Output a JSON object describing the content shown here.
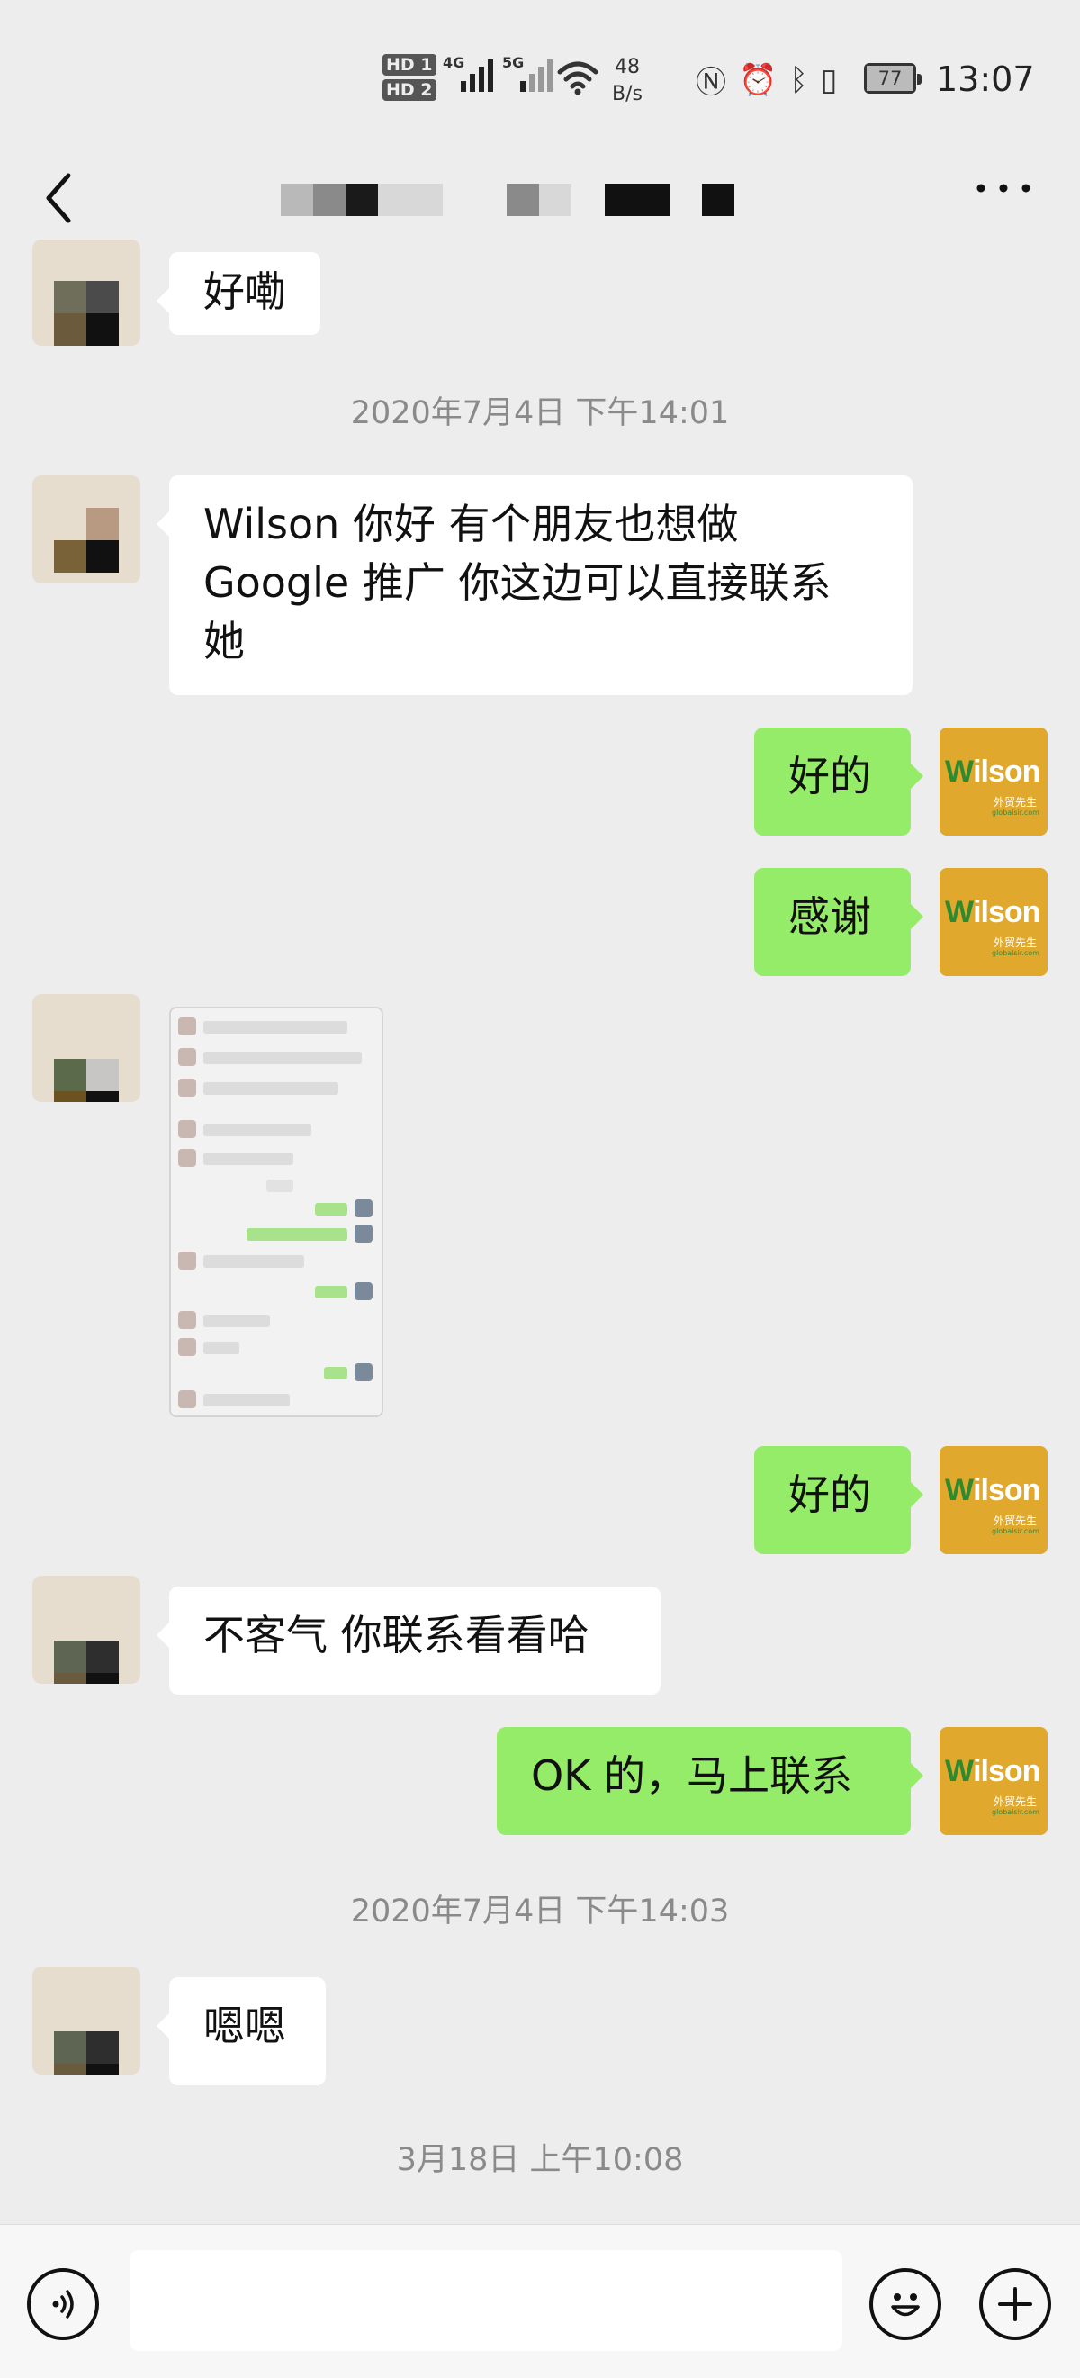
{
  "status_bar": {
    "sim1": "HD 1",
    "sim2": "HD 2",
    "net1": "4G",
    "net2": "5G",
    "speed_value": "48",
    "speed_unit": "B/s",
    "battery": "77",
    "time": "13:07"
  },
  "nav": {
    "back_icon": "chevron-left-icon",
    "more_icon": "more-dots-icon",
    "title_redacted": true
  },
  "messages": [
    {
      "side": "in",
      "text": "好嘞"
    },
    {
      "type": "time",
      "text": "2020年7月4日 下午14:01"
    },
    {
      "side": "in",
      "text": "Wilson 你好 有个朋友也想做\nGoogle 推广 你这边可以直接联系\n她"
    },
    {
      "side": "out",
      "text": "好的"
    },
    {
      "side": "out",
      "text": "感谢"
    },
    {
      "side": "in",
      "type": "image"
    },
    {
      "side": "out",
      "text": "好的"
    },
    {
      "side": "in",
      "text": "不客气 你联系看看哈"
    },
    {
      "side": "out",
      "text": "OK 的，马上联系"
    },
    {
      "type": "time",
      "text": "2020年7月4日 下午14:03"
    },
    {
      "side": "in",
      "text": "嗯嗯"
    },
    {
      "type": "time",
      "text": "3月18日 上午10:08"
    }
  ],
  "my_avatar": {
    "logo_first": "W",
    "logo_rest": "ilson",
    "tagline": "外贸先生",
    "site": "globalsir.com"
  },
  "input_bar": {
    "voice_icon": "voice-icon",
    "emoji_icon": "emoji-icon",
    "plus_icon": "plus-icon",
    "input_value": ""
  },
  "colors": {
    "background": "#ededed",
    "bubble_out": "#95ec69",
    "bubble_in": "#ffffff",
    "timestamp": "#8a8a8a"
  }
}
